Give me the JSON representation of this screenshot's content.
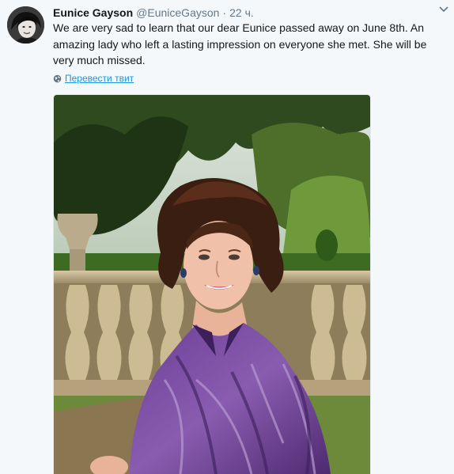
{
  "tweet": {
    "display_name": "Eunice Gayson",
    "handle": "@EuniceGayson",
    "separator": "·",
    "time": "22 ч.",
    "text": "We are very sad to learn that our dear Eunice passed away on June 8th. An amazing lady who left a lasting impression on everyone she met. She will be very much missed.",
    "translate_label": "Перевести твит"
  },
  "icons": {
    "menu": "chevron-down-icon",
    "translate": "globe-icon"
  },
  "colors": {
    "background": "#f5f8fa",
    "link": "#1b95e0",
    "secondary_text": "#657786",
    "primary_text": "#14171a"
  }
}
